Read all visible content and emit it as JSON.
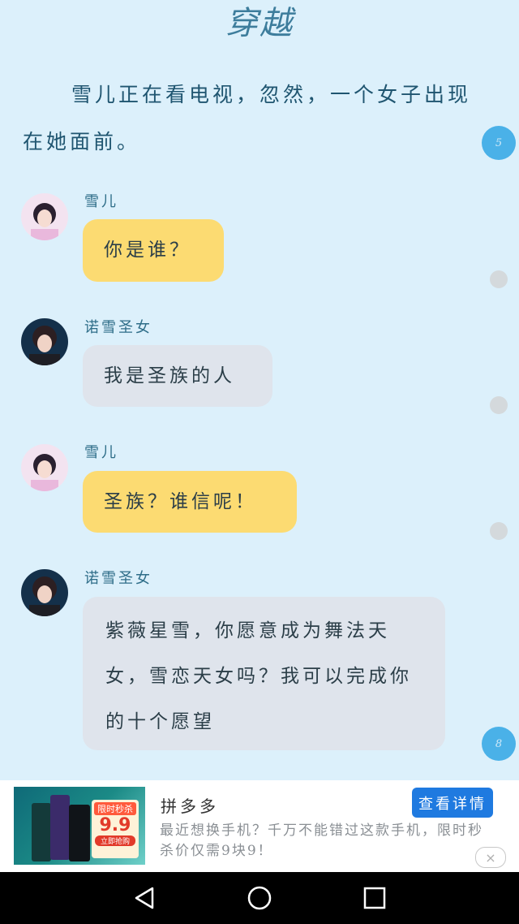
{
  "title": "穿越",
  "narration": "雪儿正在看电视，忽然，一个女子出现在她面前。",
  "badges": {
    "top": "5",
    "bottom": "8"
  },
  "messages": [
    {
      "sender": "雪儿",
      "text": "你是谁？"
    },
    {
      "sender": "诺雪圣女",
      "text": "我是圣族的人"
    },
    {
      "sender": "雪儿",
      "text": "圣族？谁信呢！"
    },
    {
      "sender": "诺雪圣女",
      "text": "紫薇星雪，你愿意成为舞法天女，雪恋天女吗？我可以完成你的十个愿望"
    }
  ],
  "ad": {
    "image_badge": "限时秒杀",
    "image_price": "9.9",
    "image_button": "立即抢购",
    "title": "拼多多",
    "description": "最近想换手机？千万不能错过这款手机，限时秒杀价仅需9块9！",
    "cta": "查看详情",
    "close": "×"
  },
  "colors": {
    "background": "#dcf0fb",
    "user_bubble": "#fcdb72",
    "other_bubble": "#dfe4ec",
    "badge": "#4ab1e8"
  }
}
